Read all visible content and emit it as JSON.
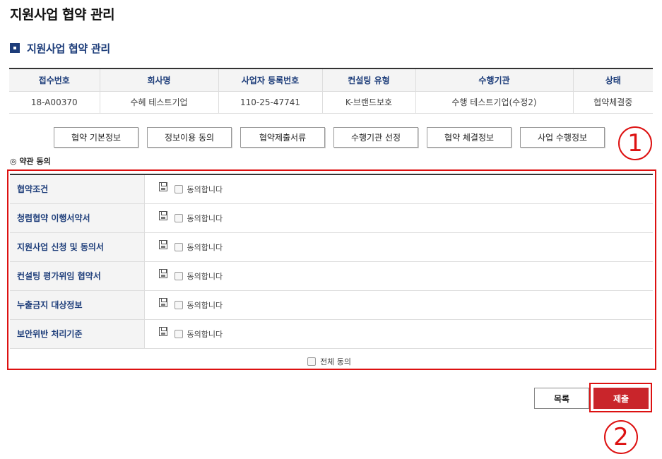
{
  "page_title": "지원사업 협약 관리",
  "section_title": "지원사업 협약 관리",
  "info_table": {
    "headers": [
      "접수번호",
      "회사명",
      "사업자 등록번호",
      "컨설팅 유형",
      "수행기관",
      "상태"
    ],
    "row": [
      "18-A00370",
      "수혜 테스트기업",
      "110-25-47741",
      "K-브랜드보호",
      "수행 테스트기업(수정2)",
      "협약체결중"
    ]
  },
  "tabs": [
    "협약 기본정보",
    "정보이용 동의",
    "협약제출서류",
    "수행기관 선정",
    "협약 체결정보",
    "사업 수행정보"
  ],
  "annotations": {
    "first": "1",
    "second": "2"
  },
  "terms_section_label": "◎ 약관 동의",
  "terms": [
    {
      "label": "협약조건",
      "agree_text": "동의합니다"
    },
    {
      "label": "청렴협약 이행서약서",
      "agree_text": "동의합니다"
    },
    {
      "label": "지원사업 신청 및 동의서",
      "agree_text": "동의합니다"
    },
    {
      "label": "컨설팅 평가위임 협약서",
      "agree_text": "동의합니다"
    },
    {
      "label": "누출금지 대상정보",
      "agree_text": "동의합니다"
    },
    {
      "label": "보안위반 처리기준",
      "agree_text": "동의합니다"
    }
  ],
  "all_agree_label": "전체 동의",
  "buttons": {
    "list": "목록",
    "submit": "제출"
  },
  "colors": {
    "accent_navy": "#1d3d7a",
    "highlight_red": "#dd1111",
    "submit_red": "#c9252b"
  },
  "icons": {
    "section_bullet": "square-bullet-icon",
    "save": "floppy-disk-icon"
  }
}
